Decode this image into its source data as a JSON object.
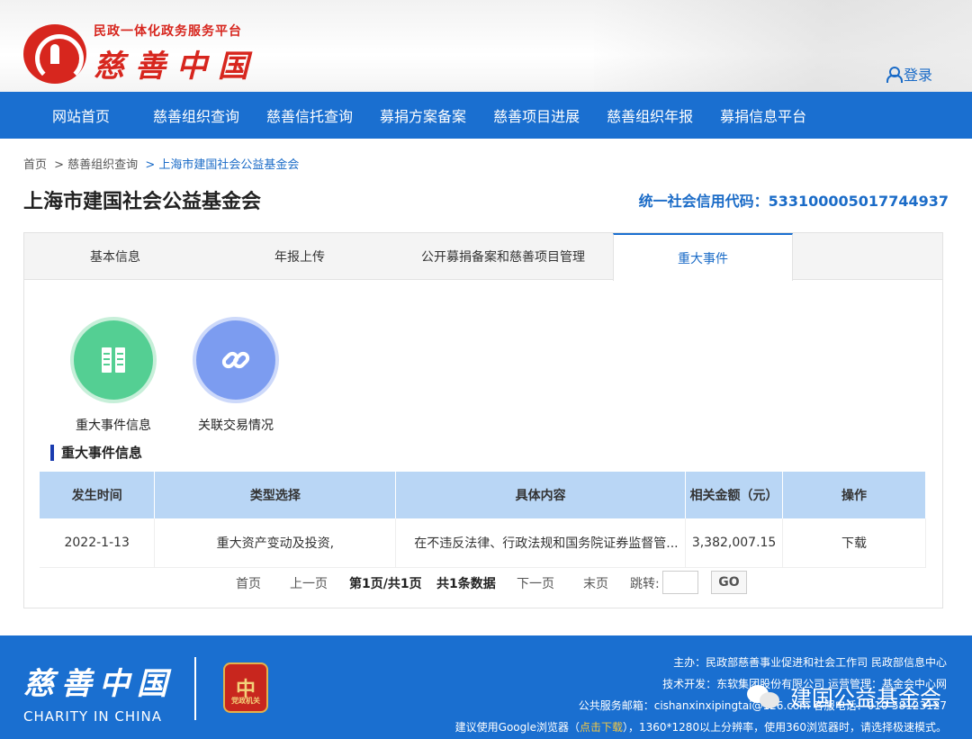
{
  "header": {
    "platform_subtitle": "民政一体化政务服务平台",
    "logo_text": "慈善中国",
    "login_label": "登录"
  },
  "nav": {
    "items": [
      "网站首页",
      "慈善组织查询",
      "慈善信托查询",
      "募捐方案备案",
      "慈善项目进展",
      "慈善组织年报",
      "募捐信息平台"
    ]
  },
  "breadcrumb": {
    "home": "首页",
    "level1": "> 慈善组织查询",
    "current": "> 上海市建国社会公益基金会"
  },
  "org": {
    "name": "上海市建国社会公益基金会",
    "credit_code": "统一社会信用代码：533100005017744937"
  },
  "tabs": {
    "items": [
      "基本信息",
      "年报上传",
      "公开募捐备案和慈善项目管理",
      "重大事件"
    ],
    "active": "重大事件"
  },
  "shortcuts": {
    "major_events": "重大事件信息",
    "related_transactions": "关联交易情况"
  },
  "section": {
    "title": "重大事件信息"
  },
  "table": {
    "headers": [
      "发生时间",
      "类型选择",
      "具体内容",
      "相关金额（元）",
      "操作"
    ],
    "rows": [
      {
        "date": "2022-1-13",
        "type": "重大资产变动及投资,",
        "content": "在不违反法律、行政法规和国务院证券监督管...",
        "amount": "3,382,007.15",
        "action": "下载"
      }
    ]
  },
  "pager": {
    "first": "首页",
    "prev": "上一页",
    "page_info": "第1页/共1页",
    "total_info": "共1条数据",
    "next": "下一页",
    "last": "末页",
    "jump_label": "跳转:",
    "go_label": "GO"
  },
  "footer": {
    "logo_cn": "慈善中国",
    "logo_en": "CHARITY IN CHINA",
    "badge_text": "中",
    "badge_sub": "党政机关",
    "line1": "主办：民政部慈善事业促进和社会工作司   民政部信息中心",
    "line2": "技术开发：东软集团股份有限公司   运营管理：基金会中心网",
    "line3": "公共服务邮箱：cishanxinxipingtai@126.com   客服电话：010-58123127",
    "line4_pre": "建议使用Google浏览器（",
    "line4_link": "点击下载",
    "line4_post": "），1360*1280以上分辨率，使用360浏览器时，请选择极速模式。",
    "watermark": "建国公益基金会"
  }
}
